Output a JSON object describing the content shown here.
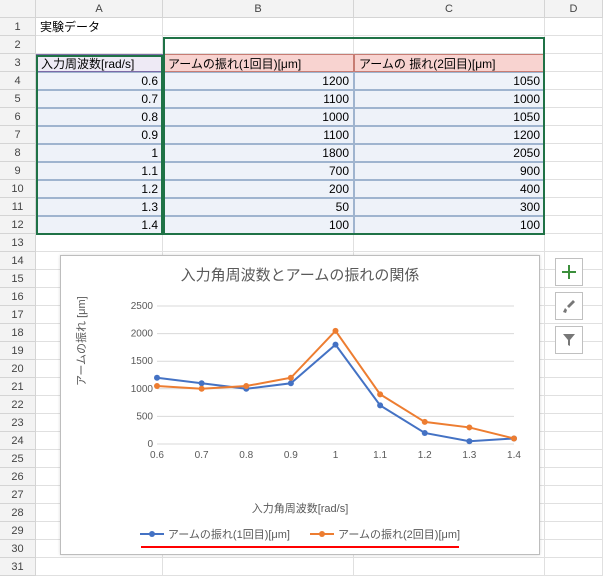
{
  "headers": {
    "A": "A",
    "B": "B",
    "C": "C",
    "D": "D"
  },
  "rows": [
    "1",
    "2",
    "3",
    "4",
    "5",
    "6",
    "7",
    "8",
    "9",
    "10",
    "11",
    "12",
    "13",
    "14",
    "15",
    "16",
    "17",
    "18",
    "19",
    "20",
    "21",
    "22",
    "23",
    "24",
    "25",
    "26",
    "27",
    "28",
    "29",
    "30",
    "31"
  ],
  "title_cell": "実験データ",
  "col_headers": {
    "freq": "入力周波数[rad/s]",
    "arm1": "アームの振れ(1回目)[μm]",
    "arm2": "アームの 振れ(2回目)[μm]"
  },
  "data": [
    {
      "f": "0.6",
      "a1": "1200",
      "a2": "1050"
    },
    {
      "f": "0.7",
      "a1": "1100",
      "a2": "1000"
    },
    {
      "f": "0.8",
      "a1": "1000",
      "a2": "1050"
    },
    {
      "f": "0.9",
      "a1": "1100",
      "a2": "1200"
    },
    {
      "f": "1",
      "a1": "1800",
      "a2": "2050"
    },
    {
      "f": "1.1",
      "a1": "700",
      "a2": "900"
    },
    {
      "f": "1.2",
      "a1": "200",
      "a2": "400"
    },
    {
      "f": "1.3",
      "a1": "50",
      "a2": "300"
    },
    {
      "f": "1.4",
      "a1": "100",
      "a2": "100"
    }
  ],
  "chart": {
    "title": "入力角周波数とアームの振れの関係",
    "xlabel": "入力角周波数[rad/s]",
    "ylabel": "アームの振れ [μm]",
    "legend1": "アームの振れ(1回目)[μm]",
    "legend2": "アームの振れ(2回目)[μm]"
  },
  "chart_data": {
    "type": "line",
    "title": "入力角周波数とアームの振れの関係",
    "xlabel": "入力角周波数[rad/s]",
    "ylabel": "アームの振れ [μm]",
    "x": [
      0.6,
      0.7,
      0.8,
      0.9,
      1.0,
      1.1,
      1.2,
      1.3,
      1.4
    ],
    "xlim": [
      0.6,
      1.4
    ],
    "ylim": [
      0,
      2500
    ],
    "yticks": [
      0,
      500,
      1000,
      1500,
      2000,
      2500
    ],
    "series": [
      {
        "name": "アームの振れ(1回目)[μm]",
        "color": "#4472c4",
        "values": [
          1200,
          1100,
          1000,
          1100,
          1800,
          700,
          200,
          50,
          100
        ]
      },
      {
        "name": "アームの振れ(2回目)[μm]",
        "color": "#ed7d31",
        "values": [
          1050,
          1000,
          1050,
          1200,
          2050,
          900,
          400,
          300,
          100
        ]
      }
    ]
  }
}
